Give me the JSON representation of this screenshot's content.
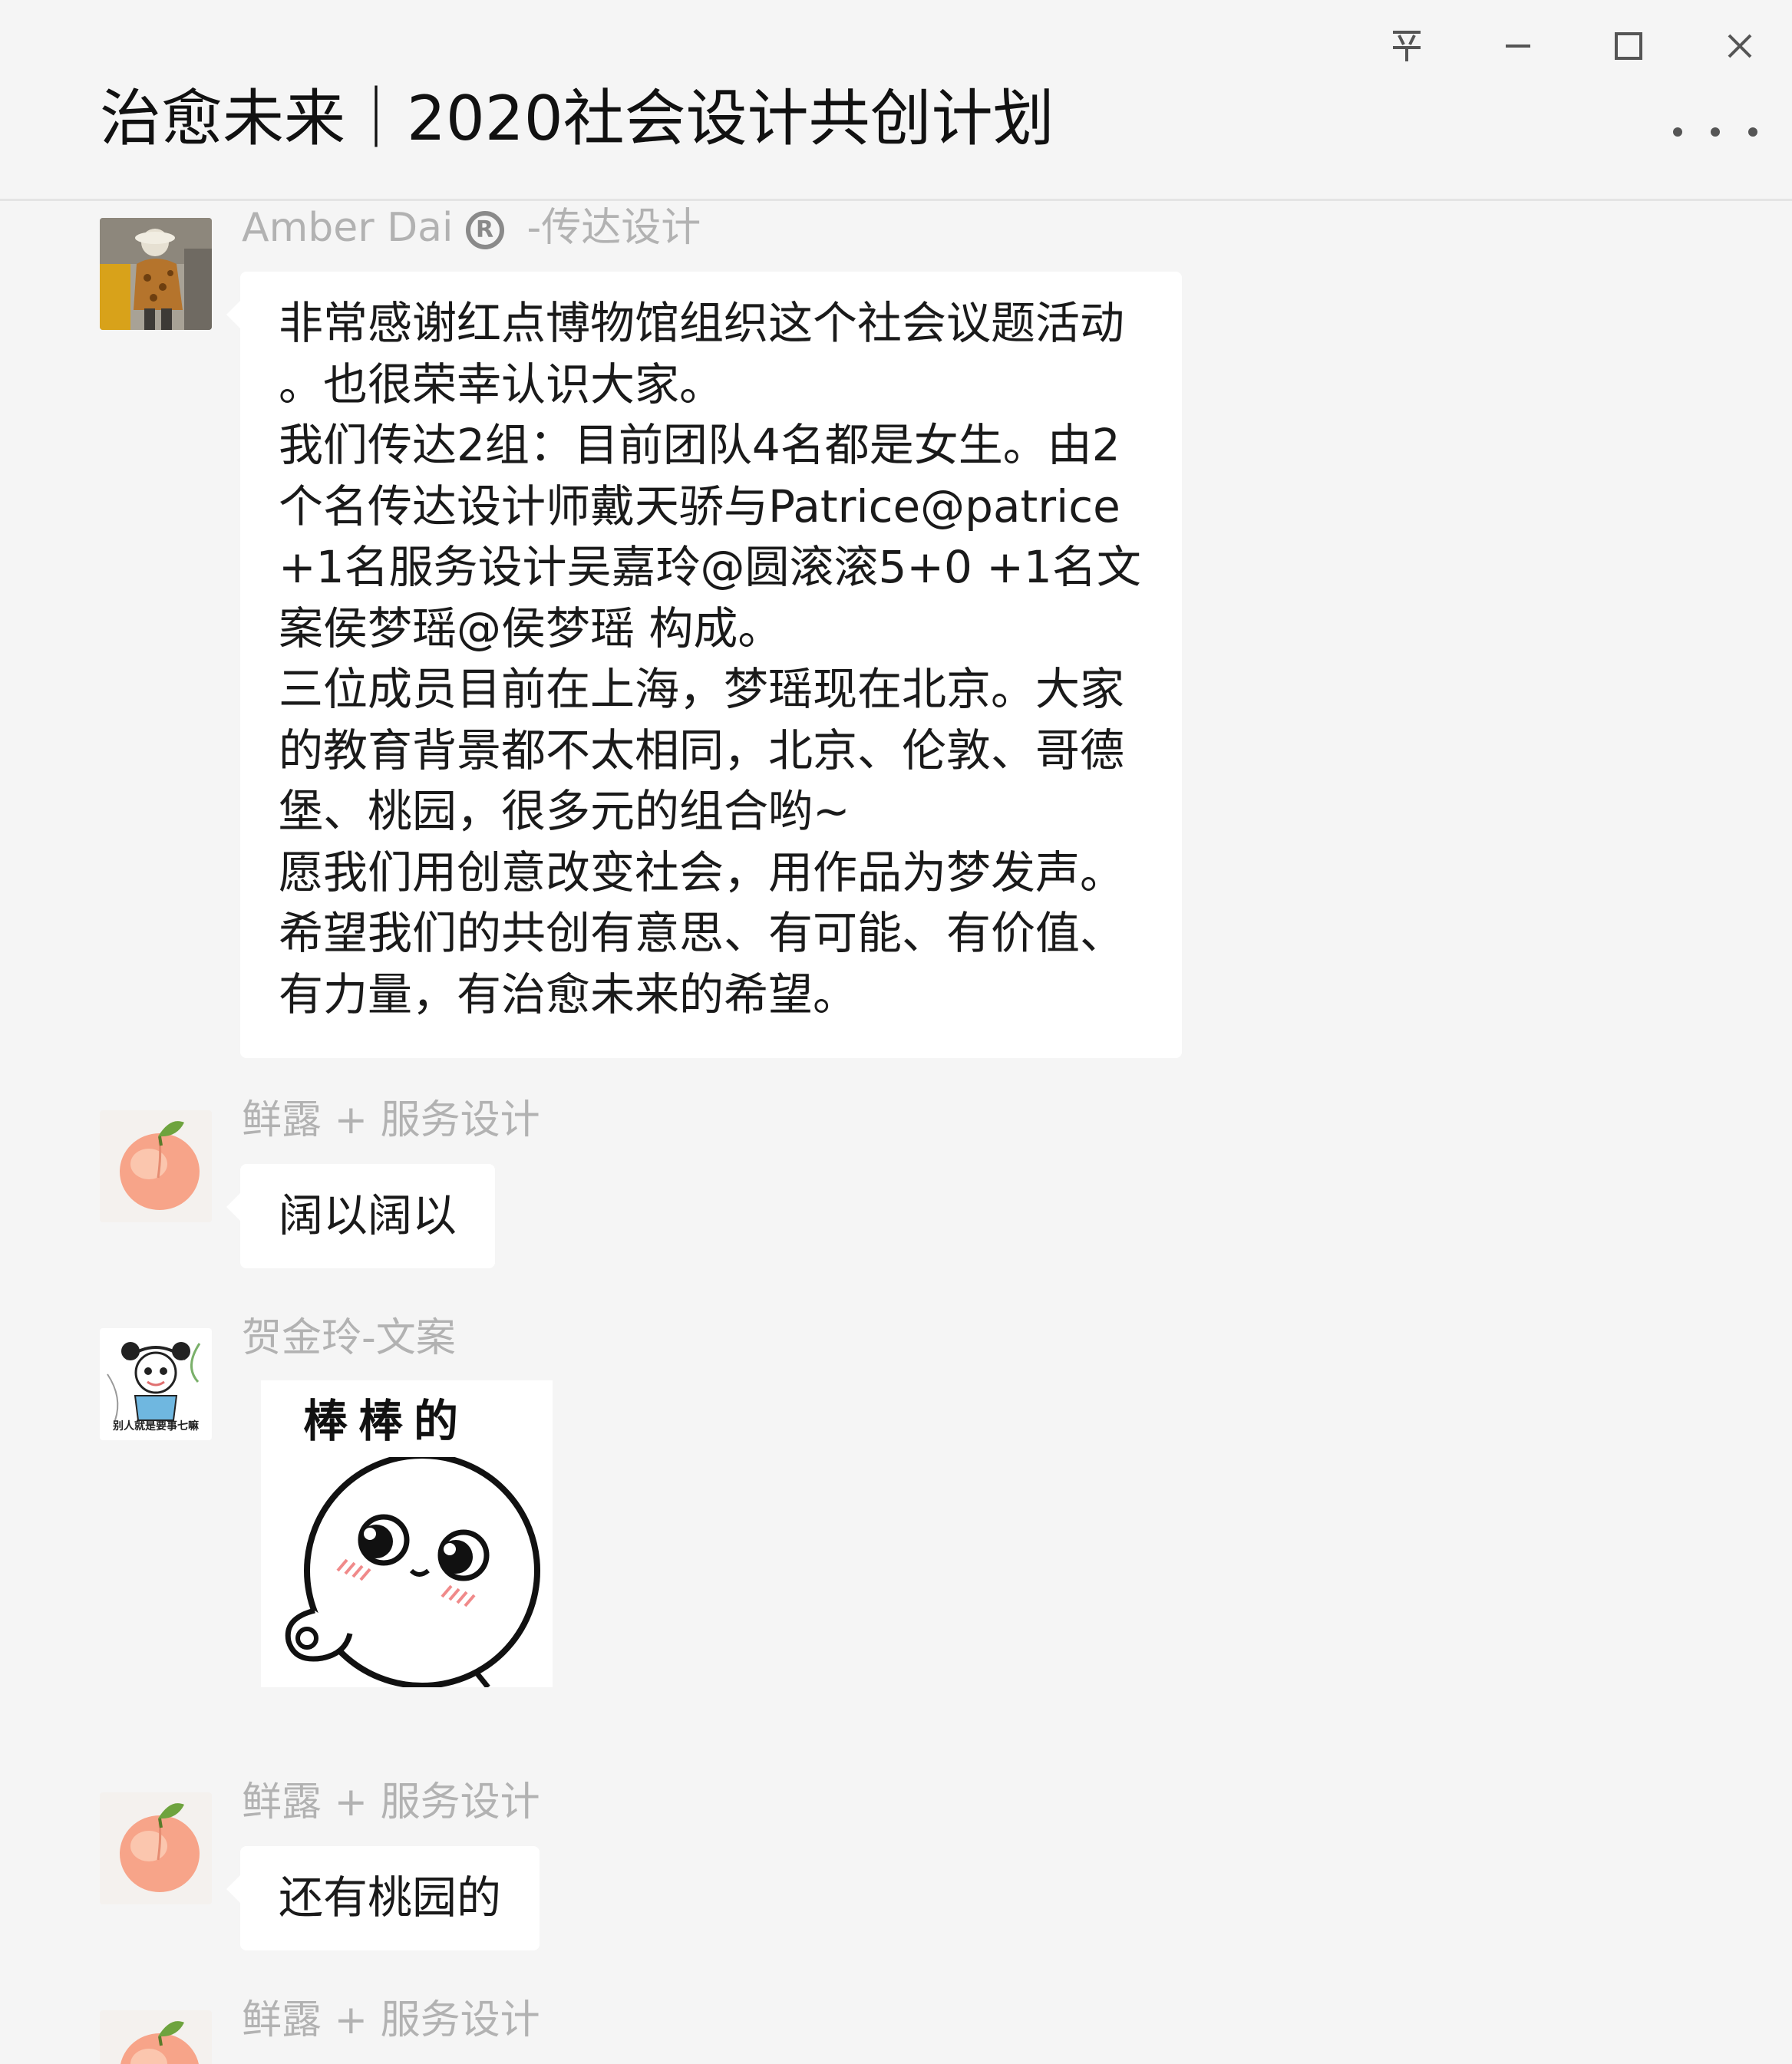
{
  "window": {
    "title": "治愈未来｜2020社会设计共创计划",
    "controls": {
      "pin": "pin-icon",
      "minimize": "minimize-icon",
      "maximize": "maximize-icon",
      "close": "close-icon",
      "more": "more-icon"
    }
  },
  "messages": [
    {
      "sender": "Amber Dai",
      "sender_badge": "R",
      "sender_suffix": "-传达设计",
      "avatar": "photo-avatar",
      "type": "text",
      "lines": [
        "非常感谢红点博物馆组织这个社会议题活动",
        "。也很荣幸认识大家。",
        "我们传达2组：目前团队4名都是女生。由2",
        "个名传达设计师戴天骄与Patrice@patrice",
        "+1名服务设计吴嘉玲@圆滚滚5+0 +1名文",
        "案侯梦瑶@侯梦瑶 构成。",
        "三位成员目前在上海，梦瑶现在北京。大家",
        "的教育背景都不太相同，北京、伦敦、哥德",
        "堡、桃园，很多元的组合哟~",
        "愿我们用创意改变社会，用作品为梦发声。",
        "希望我们的共创有意思、有可能、有价值、",
        "有力量，有治愈未来的希望。"
      ]
    },
    {
      "sender": "鲜露 + 服务设计",
      "avatar": "peach-avatar",
      "type": "text",
      "lines": [
        "阔以阔以"
      ]
    },
    {
      "sender": "贺金玲-文案",
      "avatar": "cartoon-avatar",
      "avatar_caption": "别人就是要事七嘛",
      "type": "sticker",
      "sticker_text": "棒棒的",
      "sticker": "bangbang-sticker"
    },
    {
      "sender": "鲜露 + 服务设计",
      "avatar": "peach-avatar",
      "type": "text",
      "lines": [
        "还有桃园的"
      ]
    },
    {
      "sender": "鲜露 + 服务设计",
      "avatar": "peach-avatar",
      "type": "text",
      "lines": []
    }
  ]
}
